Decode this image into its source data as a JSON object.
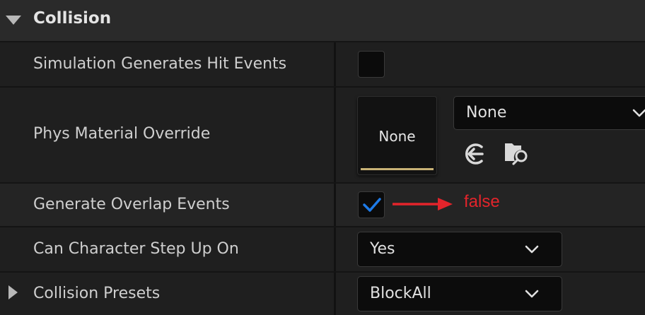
{
  "section": {
    "title": "Collision",
    "expanded": true
  },
  "rows": {
    "hit_events": {
      "label": "Simulation Generates Hit Events",
      "checked": false
    },
    "phys_material": {
      "label": "Phys Material Override",
      "thumbnail_text": "None",
      "combo_value": "None",
      "icons": [
        "use-selected-icon",
        "browse-asset-icon"
      ]
    },
    "overlap_events": {
      "label": "Generate Overlap Events",
      "checked": true,
      "annotation": "false"
    },
    "step_up": {
      "label": "Can Character Step Up On",
      "combo_value": "Yes"
    },
    "presets": {
      "label": "Collision Presets",
      "combo_value": "BlockAll",
      "expanded": false
    }
  },
  "colors": {
    "check": "#1e7be8",
    "annotation": "#e3242b",
    "thumb_bar": "#c8b276"
  }
}
